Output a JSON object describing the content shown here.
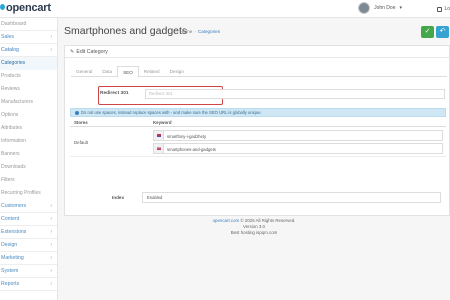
{
  "header": {
    "logo": "opencart",
    "user_name": "John Doe",
    "logout_label": "Lo"
  },
  "sidebar": {
    "items": [
      {
        "label": "Dashboard",
        "type": "item"
      },
      {
        "label": "Sales",
        "type": "item"
      },
      {
        "label": "Catalog",
        "type": "item"
      },
      {
        "label": "Categories",
        "type": "sub-current"
      },
      {
        "label": "Products",
        "type": "sub"
      },
      {
        "label": "Reviews",
        "type": "sub"
      },
      {
        "label": "Manufacturers",
        "type": "sub"
      },
      {
        "label": "Options",
        "type": "sub"
      },
      {
        "label": "Attributes",
        "type": "sub"
      },
      {
        "label": "Information",
        "type": "sub"
      },
      {
        "label": "Banners",
        "type": "sub"
      },
      {
        "label": "Downloads",
        "type": "sub"
      },
      {
        "label": "Filters",
        "type": "sub"
      },
      {
        "label": "Recurring Profiles",
        "type": "sub"
      },
      {
        "label": "Customers",
        "type": "item"
      },
      {
        "label": "Content",
        "type": "item"
      },
      {
        "label": "Extensions",
        "type": "item"
      },
      {
        "label": "Design",
        "type": "item"
      },
      {
        "label": "Marketing",
        "type": "item"
      },
      {
        "label": "System",
        "type": "item"
      },
      {
        "label": "Reports",
        "type": "item"
      }
    ]
  },
  "page": {
    "title": "Smartphones and gadgets",
    "breadcrumb_home": "Home",
    "breadcrumb_current": "Categories"
  },
  "panel": {
    "heading": "Edit Category",
    "tabs": [
      "General",
      "Data",
      "SEO",
      "Related",
      "Design"
    ],
    "active_tab": "SEO"
  },
  "form": {
    "redirect_label": "Redirect 301",
    "redirect_placeholder": "Redirect 301",
    "alert_text": "Do not use spaces, instead replace spaces with - and make sure the SEO URL is globally unique.",
    "col_stores": "Stores",
    "col_keyword": "Keyword",
    "store_default": "Default",
    "keyword_1": "smartfony-i-gadzhety",
    "keyword_2": "smartphones-and-gadgets",
    "index_label": "Index",
    "index_value": "Enabled"
  },
  "footer": {
    "link": "opencart.com",
    "copyright": " © 2026 All Rights Reserved.",
    "version": "Version 3.0",
    "hosting": "Best hosting ispqm.com"
  },
  "colors": {
    "save_button": "#45a74a",
    "back_button": "#36a3d1",
    "highlight_border": "#d04545"
  }
}
